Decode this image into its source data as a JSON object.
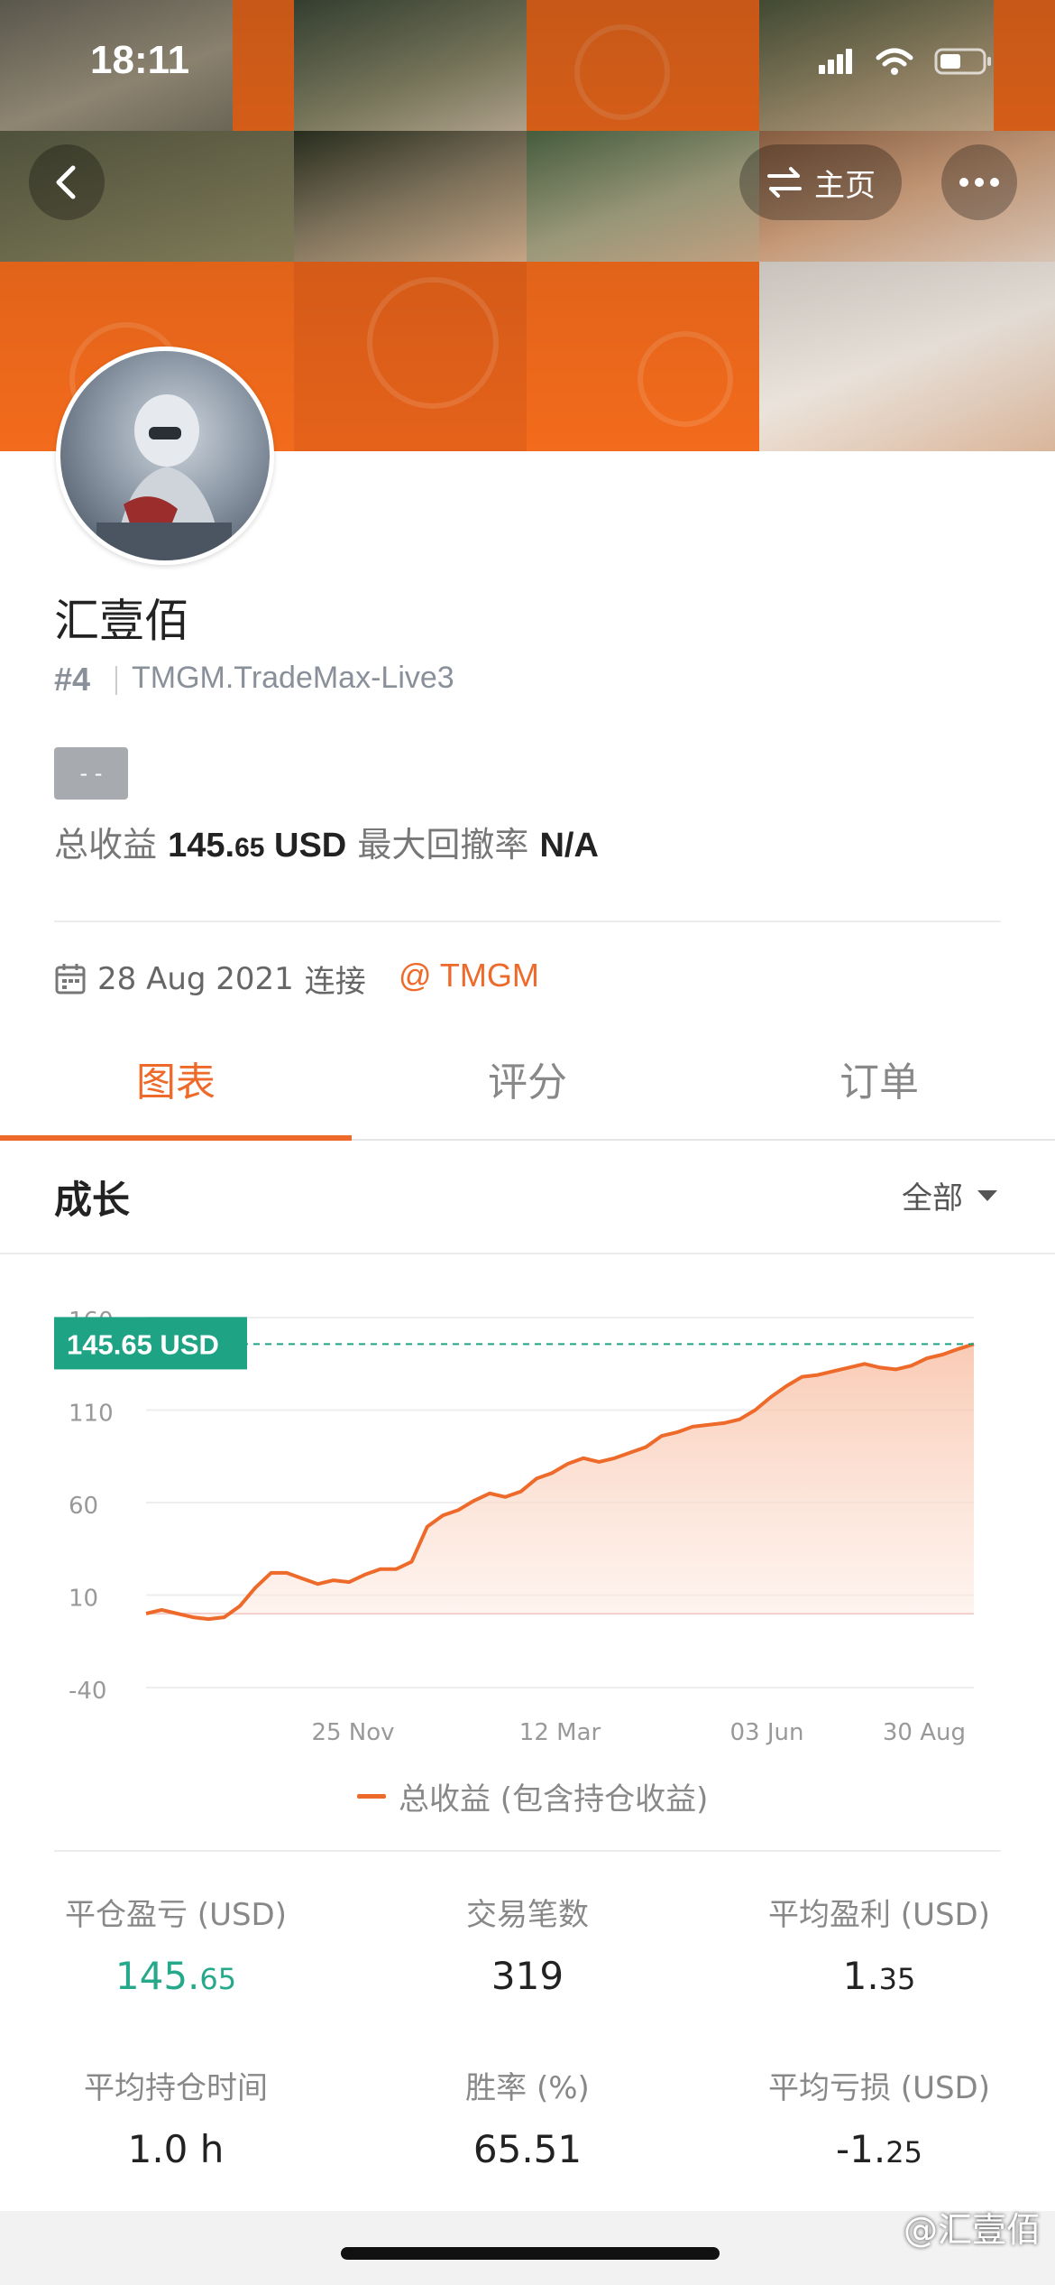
{
  "status_bar": {
    "time": "18:11"
  },
  "header": {
    "home_label": "主页"
  },
  "profile": {
    "name": "汇壹佰",
    "rank": "#4",
    "server": "TMGM.TradeMax-Live3",
    "tag": "- -",
    "total_profit_label": "总收益",
    "total_profit_int": "145.",
    "total_profit_dec": "65",
    "total_profit_unit": "USD",
    "max_drawdown_label": "最大回撤率",
    "max_drawdown_value": "N/A",
    "connected_date": "28 Aug 2021",
    "connected_label": "连接",
    "broker": "@ TMGM"
  },
  "tabs": [
    {
      "label": "图表",
      "active": true
    },
    {
      "label": "评分",
      "active": false
    },
    {
      "label": "订单",
      "active": false
    }
  ],
  "section": {
    "title": "成长",
    "range_label": "全部"
  },
  "chart_data": {
    "type": "area",
    "series": [
      {
        "name": "总收益 (包含持仓收益)"
      }
    ],
    "y_ticks": [
      "160",
      "110",
      "60",
      "10",
      "-40"
    ],
    "x_ticks": [
      "25 Nov",
      "12 Mar",
      "03 Jun",
      "30 Aug"
    ],
    "ylim": [
      -40,
      160
    ],
    "current_value_label": "145.65 USD",
    "current_value": 145.65,
    "values": [
      0,
      2,
      0,
      -2,
      -3,
      -2,
      4,
      14,
      22,
      22,
      19,
      16,
      18,
      17,
      21,
      24,
      24,
      28,
      47,
      53,
      56,
      61,
      65,
      63,
      66,
      73,
      76,
      81,
      84,
      82,
      84,
      87,
      90,
      96,
      98,
      101,
      102,
      103,
      105,
      110,
      117,
      123,
      128,
      129,
      131,
      133,
      135,
      133,
      132,
      134,
      138,
      140,
      143,
      145.65
    ],
    "color": "#ee6a2a",
    "label_color": "#1fa385"
  },
  "stats": [
    {
      "label": "平仓盈亏 (USD)",
      "int": "145.",
      "dec": "65",
      "green": true
    },
    {
      "label": "交易笔数",
      "int": "319",
      "dec": "",
      "green": false
    },
    {
      "label": "平均盈利 (USD)",
      "int": "1.",
      "dec": "35",
      "green": false
    },
    {
      "label": "平均持仓时间",
      "int": "1.0 h",
      "dec": "",
      "green": false
    },
    {
      "label": "胜率 (%)",
      "int": "65.51",
      "dec": "",
      "green": false
    },
    {
      "label": "平均亏损 (USD)",
      "int": "-1.",
      "dec": "25",
      "green": false
    }
  ],
  "watermark": "@汇壹佰"
}
